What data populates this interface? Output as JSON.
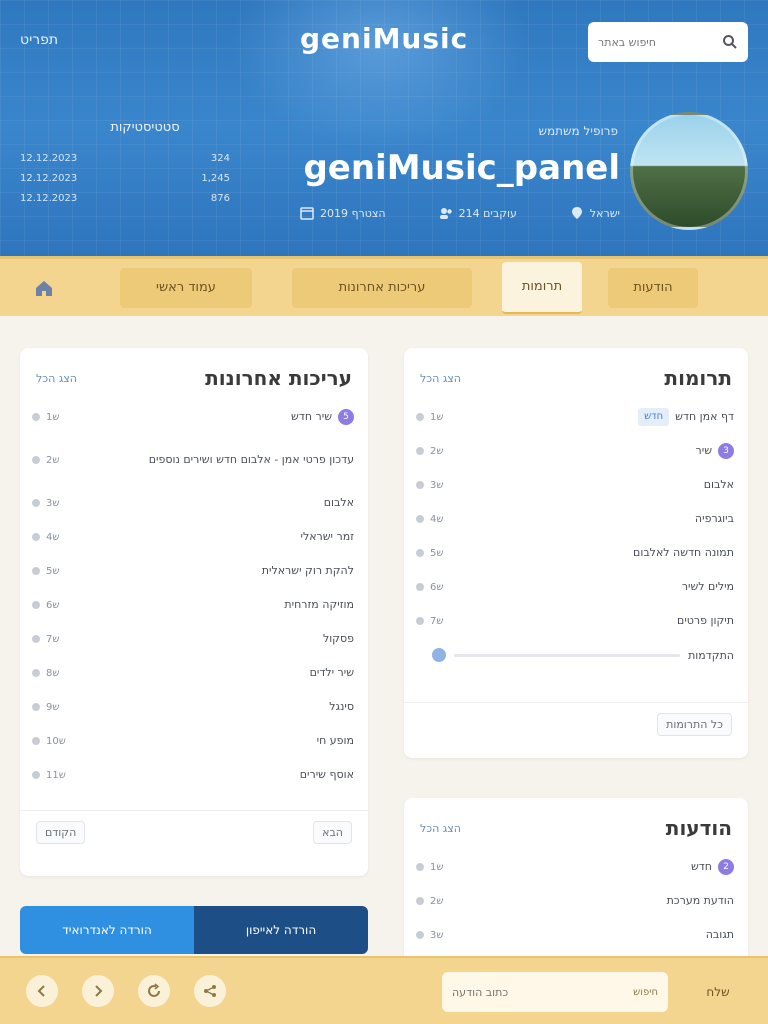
{
  "colors": {
    "header_blue": "#2f78bf",
    "nav_yellow": "#f3d58f",
    "badge_purple": "#8d7be6",
    "tag_blue": "#4b82cc"
  },
  "header": {
    "menu_label": "תפריט",
    "brand": "geniMusic",
    "search_placeholder": "חיפוש באתר"
  },
  "stats": {
    "title": "סטטיסטיקות",
    "rows": [
      {
        "label": "12.12.2023",
        "value": "324"
      },
      {
        "label": "12.12.2023",
        "value": "1,245"
      },
      {
        "label": "12.12.2023",
        "value": "876"
      }
    ]
  },
  "profile": {
    "subtitle": "פרופיל משתמש",
    "name": "geniMusic_panel",
    "meta": [
      {
        "icon": "calendar-icon",
        "text": "הצטרף 2019"
      },
      {
        "icon": "users-icon",
        "text": "עוקבים 214"
      },
      {
        "icon": "location-icon",
        "text": "ישראל"
      }
    ]
  },
  "nav": {
    "home_icon": "home-icon",
    "tabs": [
      {
        "label": "עמוד ראשי"
      },
      {
        "label": "עריכות אחרונות"
      },
      {
        "label": "תרומות"
      },
      {
        "label": "הודעות"
      }
    ]
  },
  "left_card": {
    "title": "עריכות אחרונות",
    "link": "הצג הכל",
    "rows": [
      {
        "age": "1ש",
        "text": "שיר חדש",
        "badge": "5"
      },
      {
        "age": "2ש",
        "text": "עדכון פרטי אמן - אלבום חדש ושירים נוספים"
      },
      {
        "age": "3ש",
        "text": "אלבום"
      },
      {
        "age": "4ש",
        "text": "זמר ישראלי"
      },
      {
        "age": "5ש",
        "text": "להקת רוק ישראלית"
      },
      {
        "age": "6ש",
        "text": "מוזיקה מזרחית"
      },
      {
        "age": "7ש",
        "text": "פסקול"
      },
      {
        "age": "8ש",
        "text": "שיר ילדים"
      },
      {
        "age": "9ש",
        "text": "סינגל"
      },
      {
        "age": "10ש",
        "text": "מופע חי"
      },
      {
        "age": "11ש",
        "text": "אוסף שירים"
      }
    ],
    "foot_left": "הקודם",
    "foot_right": "הבא"
  },
  "right_card1": {
    "title": "תרומות",
    "link": "הצג הכל",
    "rows": [
      {
        "age": "1ש",
        "text": "דף אמן חדש",
        "tag": "חדש"
      },
      {
        "age": "2ש",
        "text": "שיר",
        "badge": "3"
      },
      {
        "age": "3ש",
        "text": "אלבום"
      },
      {
        "age": "4ש",
        "text": "ביוגרפיה"
      },
      {
        "age": "5ש",
        "text": "תמונה חדשה לאלבום"
      },
      {
        "age": "6ש",
        "text": "מילים לשיר"
      },
      {
        "age": "7ש",
        "text": "תיקון פרטים"
      }
    ],
    "progress_label": "התקדמות",
    "foot_right": "כל התרומות"
  },
  "right_card2": {
    "title": "הודעות",
    "link": "הצג הכל",
    "rows": [
      {
        "age": "1ש",
        "text": "חדש",
        "badge": "2"
      },
      {
        "age": "2ש",
        "text": "הודעת מערכת"
      },
      {
        "age": "3ש",
        "text": "תגובה"
      }
    ]
  },
  "banner": {
    "left_label": "הורדה לאנדרואיד",
    "right_label": "הורדה לאייפון"
  },
  "bottom": {
    "buttons": [
      "back-icon",
      "forward-icon",
      "refresh-icon",
      "share-icon"
    ],
    "input_placeholder": "כתוב הודעה",
    "input_hint": "חיפוש",
    "submit": "שלח"
  }
}
